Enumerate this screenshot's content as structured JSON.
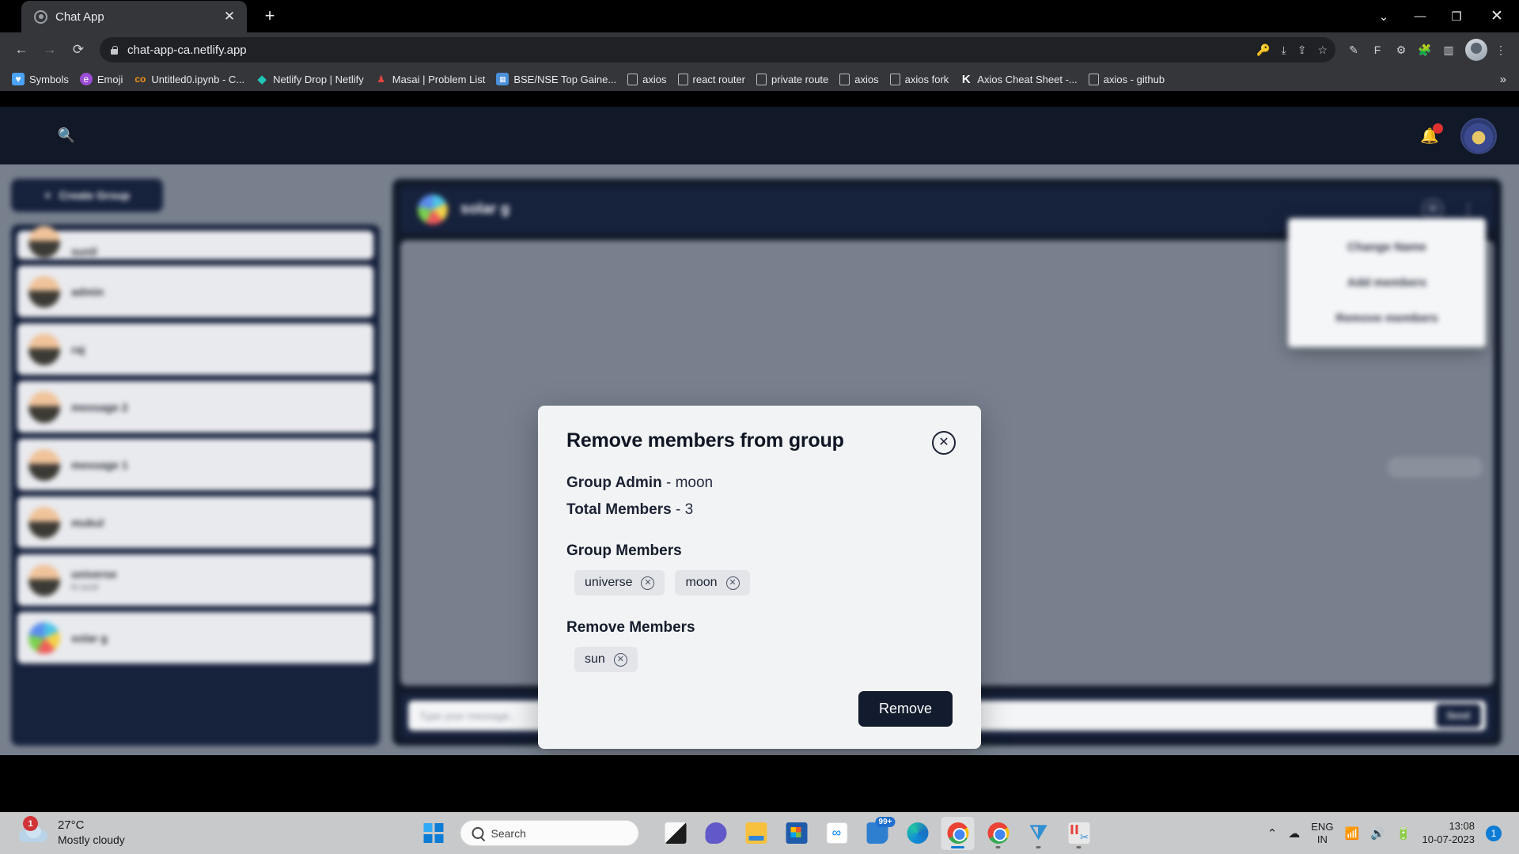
{
  "browser": {
    "tab": {
      "title": "Chat App",
      "favicon": "chat-bubble-icon",
      "close": "✕"
    },
    "newtab_label": "+",
    "window_controls": {
      "minimize_chevron": "⌄",
      "minimize": "—",
      "maximize": "❐",
      "close": "✕"
    },
    "nav": {
      "back": "←",
      "forward": "→",
      "reload": "⟳"
    },
    "omnibox": {
      "url": "chat-app-ca.netlify.app",
      "lock": "lock-icon"
    },
    "omnibox_actions": {
      "password": "🔑",
      "download": "⤓",
      "share": "⇪",
      "bookmark": "☆"
    },
    "extensions": {
      "pen": "✎",
      "f_ext": "F",
      "gear": "⚙",
      "puzzle": "🧩",
      "sidepanel": "▥"
    },
    "bookmarks": [
      {
        "label": "Symbols",
        "icon": "heart-icon",
        "glyph": "♥",
        "color": "#4aa3f5"
      },
      {
        "label": "Emoji",
        "icon": "emoji-icon",
        "glyph": "e",
        "color": "#9b4dd6"
      },
      {
        "label": "Untitled0.ipynb - C...",
        "icon": "colab-icon",
        "glyph": "co",
        "color": "#f29119"
      },
      {
        "label": "Netlify Drop | Netlify",
        "icon": "netlify-diamond-icon",
        "glyph": "◆",
        "color": "#20c6b7"
      },
      {
        "label": "Masai | Problem List",
        "icon": "masai-icon",
        "glyph": "♟",
        "color": "#e0463f"
      },
      {
        "label": "BSE/NSE Top Gaine...",
        "icon": "chart-icon",
        "glyph": "▦",
        "color": "#4a90d9"
      },
      {
        "label": "axios",
        "icon": "blank-page-icon",
        "glyph": "",
        "color": ""
      },
      {
        "label": "react router",
        "icon": "blank-page-icon",
        "glyph": "",
        "color": ""
      },
      {
        "label": "private route",
        "icon": "blank-page-icon",
        "glyph": "",
        "color": ""
      },
      {
        "label": "axios",
        "icon": "blank-page-icon",
        "glyph": "",
        "color": ""
      },
      {
        "label": "axios fork",
        "icon": "blank-page-icon",
        "glyph": "",
        "color": ""
      },
      {
        "label": "Axios Cheat Sheet -...",
        "icon": "kindacode-k-icon",
        "glyph": "K",
        "color": "#ffffff"
      },
      {
        "label": "axios - github",
        "icon": "blank-page-icon",
        "glyph": "",
        "color": ""
      }
    ],
    "bookmarks_overflow": "»"
  },
  "app": {
    "topnav": {
      "search_icon": "search-icon",
      "notification_icon": "bell-icon",
      "notification_has_badge": true,
      "profile_icon": "user-avatar"
    },
    "sidebar": {
      "create_group_label": "Create Group",
      "create_group_plus": "+",
      "chats": [
        {
          "name": "sunil",
          "sub": "",
          "avatar": "user-avatar"
        },
        {
          "name": "admin",
          "sub": "",
          "avatar": "user-avatar"
        },
        {
          "name": "raj",
          "sub": "",
          "avatar": "user-avatar"
        },
        {
          "name": "message 2",
          "sub": "",
          "avatar": "user-avatar"
        },
        {
          "name": "message 1",
          "sub": "",
          "avatar": "user-avatar"
        },
        {
          "name": "mukul",
          "sub": "",
          "avatar": "user-avatar"
        },
        {
          "name": "universe",
          "sub": "hi sunil",
          "avatar": "user-avatar"
        },
        {
          "name": "solar g",
          "sub": "",
          "avatar": "group-avatar"
        }
      ]
    },
    "chat": {
      "header_title": "solar g",
      "header_avatar": "group-avatar",
      "view_icon": "eye-icon",
      "menu_icon": "more-vertical-icon",
      "input_placeholder": "Type your message..",
      "emoji_icon": "emoji-icon",
      "send_label": "Send"
    },
    "dropdown": {
      "items": [
        {
          "label": "Change Name"
        },
        {
          "label": "Add members"
        },
        {
          "label": "Remove members"
        }
      ]
    },
    "modal": {
      "title": "Remove members from group",
      "close_icon": "close-icon",
      "close_glyph": "✕",
      "admin_label": "Group Admin",
      "admin_sep": " - ",
      "admin_value": "moon",
      "total_label": "Total Members",
      "total_sep": " - ",
      "total_value": "3",
      "group_members_label": "Group Members",
      "group_members": [
        {
          "name": "universe",
          "remove_glyph": "✕"
        },
        {
          "name": "moon",
          "remove_glyph": "✕"
        }
      ],
      "remove_members_label": "Remove Members",
      "remove_members": [
        {
          "name": "sun",
          "remove_glyph": "✕"
        }
      ],
      "submit_label": "Remove"
    }
  },
  "taskbar": {
    "weather": {
      "temp": "27°C",
      "desc": "Mostly cloudy",
      "badge": "1",
      "icon": "cloud-icon"
    },
    "start": {
      "icon": "windows-logo-icon"
    },
    "search": {
      "placeholder": "Search",
      "icon": "search-icon"
    },
    "apps": [
      {
        "name": "lens-app",
        "icon": "lens-icon",
        "active": false,
        "running": false
      },
      {
        "name": "teams-app",
        "icon": "teams-icon",
        "active": false,
        "running": false
      },
      {
        "name": "file-explorer",
        "icon": "folder-icon",
        "active": false,
        "running": false
      },
      {
        "name": "microsoft-store",
        "icon": "store-icon",
        "active": false,
        "running": false
      },
      {
        "name": "meta-app",
        "icon": "meta-icon",
        "active": false,
        "running": false
      },
      {
        "name": "mail-app",
        "icon": "mail-icon",
        "active": false,
        "running": false,
        "badge": "99+"
      },
      {
        "name": "edge-browser",
        "icon": "edge-icon",
        "active": false,
        "running": false
      },
      {
        "name": "chrome-browser",
        "icon": "chrome-icon",
        "active": true,
        "running": true
      },
      {
        "name": "chrome-profile-window",
        "icon": "chrome-icon",
        "active": false,
        "running": true
      },
      {
        "name": "vs-code",
        "icon": "vscode-icon",
        "active": false,
        "running": true
      },
      {
        "name": "snipping-tool",
        "icon": "snipping-tool-icon",
        "active": false,
        "running": true
      }
    ],
    "tray": {
      "chevron": "⌃",
      "cloud_icon": "onedrive-icon",
      "language_line1": "ENG",
      "language_line2": "IN",
      "wifi_icon": "wifi-icon",
      "volume_icon": "volume-icon",
      "battery_icon": "battery-icon",
      "time": "13:08",
      "date": "10-07-2023",
      "notification_count": "1"
    }
  }
}
